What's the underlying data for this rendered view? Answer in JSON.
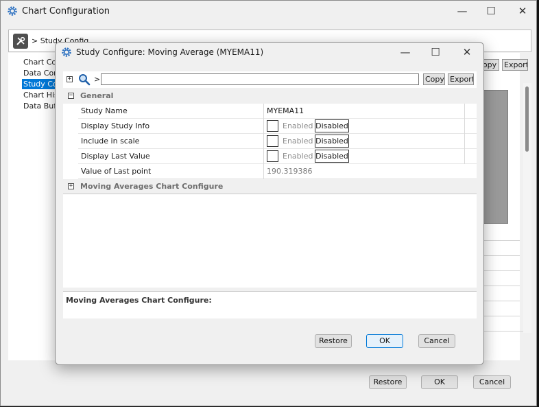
{
  "parent": {
    "title": "Chart Configuration",
    "path_text": "> Study Config",
    "tree": [
      "Chart Con",
      "Data Conf",
      "Study Con",
      "Chart Hist",
      "Data Buffe"
    ],
    "copy_label": "opy",
    "export_label": "Export",
    "buttons": {
      "restore": "Restore",
      "ok": "OK",
      "cancel": "Cancel"
    }
  },
  "dialog": {
    "title": "Study Configure: Moving Average (MYEMA11)",
    "search": {
      "prefix": ">",
      "value": ""
    },
    "copy_label": "Copy",
    "export_label": "Export",
    "sections": {
      "general": "General",
      "moving_averages": "Moving Averages Chart Configure"
    },
    "properties": {
      "study_name": {
        "label": "Study Name",
        "value": "MYEMA11"
      },
      "display_study_info": {
        "label": "Display Study Info",
        "enabled": "Enabled",
        "disabled": "Disabled"
      },
      "include_in_scale": {
        "label": "Include in scale",
        "enabled": "Enabled",
        "disabled": "Disabled"
      },
      "display_last_value": {
        "label": "Display Last Value",
        "enabled": "Enabled",
        "disabled": "Disabled"
      },
      "value_of_last_point": {
        "label": "Value of Last point",
        "value": "190.319386"
      }
    },
    "description_title": "Moving Averages Chart Configure:",
    "buttons": {
      "restore": "Restore",
      "ok": "OK",
      "cancel": "Cancel"
    }
  },
  "window_controls": {
    "minimize": "—",
    "maximize": "☐",
    "close": "✕"
  },
  "icons": {
    "app": "gear-icon",
    "tools": "tools-icon",
    "search": "magnifier-icon"
  },
  "colors": {
    "selection": "#0078d7",
    "default_button_border": "#0078d7"
  }
}
